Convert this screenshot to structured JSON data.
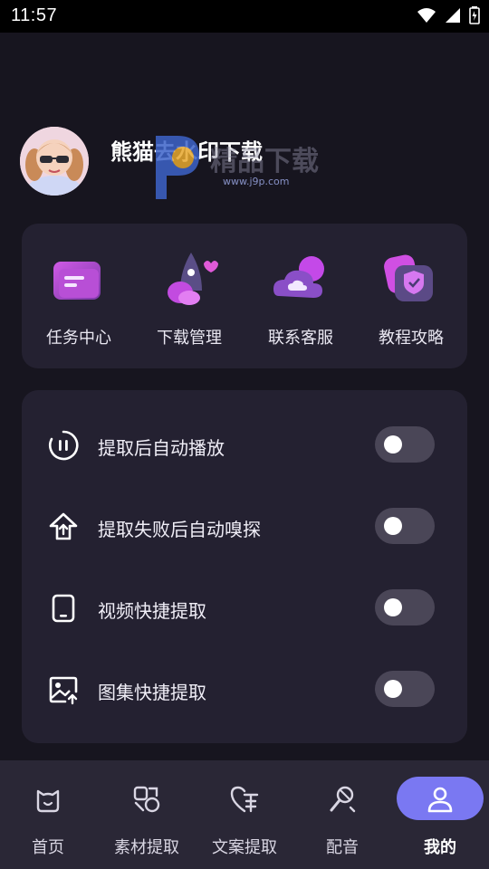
{
  "status_bar": {
    "time": "11:57",
    "icons": [
      "wifi-icon",
      "cellular-signal-icon",
      "battery-icon"
    ]
  },
  "profile": {
    "username": "熊猫去水印下载",
    "watermark_text": "www.j9p.com",
    "watermark_brand": "精品下载"
  },
  "quick_actions": [
    {
      "label": "任务中心",
      "icon": "folder-icon"
    },
    {
      "label": "下载管理",
      "icon": "rocket-icon"
    },
    {
      "label": "联系客服",
      "icon": "cloud-icon"
    },
    {
      "label": "教程攻略",
      "icon": "shield-icon"
    }
  ],
  "settings": [
    {
      "label": "提取后自动播放",
      "icon": "pause-circle-icon",
      "enabled": false
    },
    {
      "label": "提取失败后自动嗅探",
      "icon": "upload-home-icon",
      "enabled": false
    },
    {
      "label": "视频快捷提取",
      "icon": "tablet-icon",
      "enabled": false
    },
    {
      "label": "图集快捷提取",
      "icon": "image-upload-icon",
      "enabled": false
    }
  ],
  "bottom_nav": [
    {
      "label": "首页",
      "icon": "home-cat-icon",
      "active": false
    },
    {
      "label": "素材提取",
      "icon": "shapes-icon",
      "active": false
    },
    {
      "label": "文案提取",
      "icon": "heart-text-icon",
      "active": false
    },
    {
      "label": "配音",
      "icon": "microphone-icon",
      "active": false
    },
    {
      "label": "我的",
      "icon": "user-icon",
      "active": true
    }
  ],
  "colors": {
    "background": "#17151f",
    "card": "#242131",
    "nav_bar": "#2a2736",
    "accent": "#7a78f2",
    "toggle_off": "#4a4657"
  }
}
